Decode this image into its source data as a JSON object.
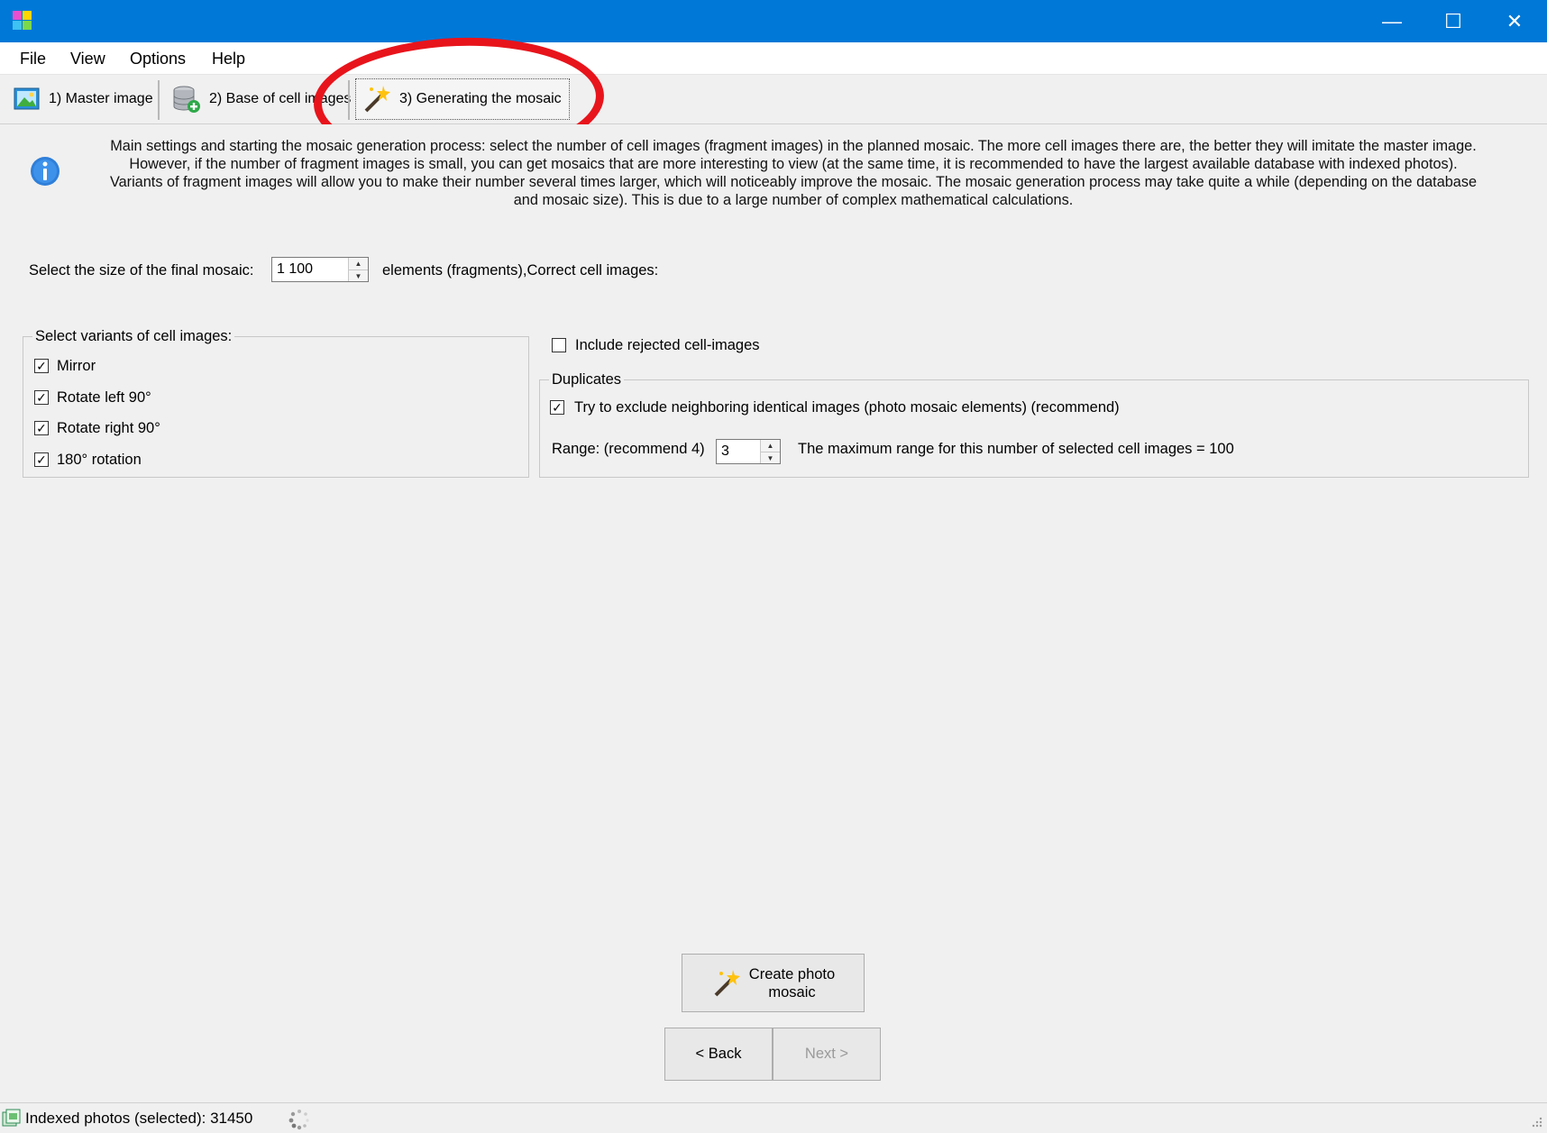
{
  "window": {
    "minimize_glyph": "—",
    "maximize_glyph": "☐",
    "close_glyph": "✕"
  },
  "menu": {
    "items": [
      {
        "label": "File"
      },
      {
        "label": "View"
      },
      {
        "label": "Options"
      },
      {
        "label": "Help"
      }
    ]
  },
  "tabs": [
    {
      "label": "1) Master image",
      "icon": "master-image-icon"
    },
    {
      "label": "2) Base of cell images",
      "icon": "database-add-icon"
    },
    {
      "label": "3) Generating the mosaic",
      "icon": "magic-wand-icon"
    }
  ],
  "info": {
    "icon": "info-icon",
    "lines": [
      "Main settings and starting the mosaic generation process: select the number of cell images (fragment images) in the planned mosaic. The more cell images there are, the better they will imitate the master image.",
      "However, if the number of fragment images is small, you can get mosaics that are more interesting to view (at the same time, it is recommended to have the largest available database with indexed photos).",
      "Variants of fragment images will allow you to make their number several times larger, which will noticeably improve the mosaic. The mosaic generation process may take quite a while (depending on the database",
      "and mosaic size). This is due to a large number of complex mathematical calculations."
    ]
  },
  "size": {
    "label": "Select the size of the final mosaic:",
    "value": "1 100",
    "suffix": "elements (fragments),Correct cell images:"
  },
  "variants": {
    "title": "Select variants of cell images:",
    "options": [
      {
        "label": "Mirror",
        "checked": true
      },
      {
        "label": "Rotate left 90°",
        "checked": true
      },
      {
        "label": "Rotate right 90°",
        "checked": true
      },
      {
        "label": "180° rotation",
        "checked": true
      }
    ]
  },
  "rejected": {
    "label": "Include rejected cell-images",
    "checked": false
  },
  "duplicates": {
    "title": "Duplicates",
    "exclude_label": "Try to exclude neighboring identical images (photo mosaic elements) (recommend)",
    "exclude_checked": true,
    "range_label": "Range: (recommend 4)",
    "range_value": "3",
    "max_range_text": "The maximum range for this number of selected cell images = 100"
  },
  "buttons": {
    "create_line1": "Create photo",
    "create_line2": "mosaic",
    "back": "< Back",
    "next": "Next >"
  },
  "status": {
    "indexed_text": "Indexed photos (selected): 31450"
  },
  "colors": {
    "titlebar": "#0078d7",
    "highlight": "#e8141c"
  }
}
